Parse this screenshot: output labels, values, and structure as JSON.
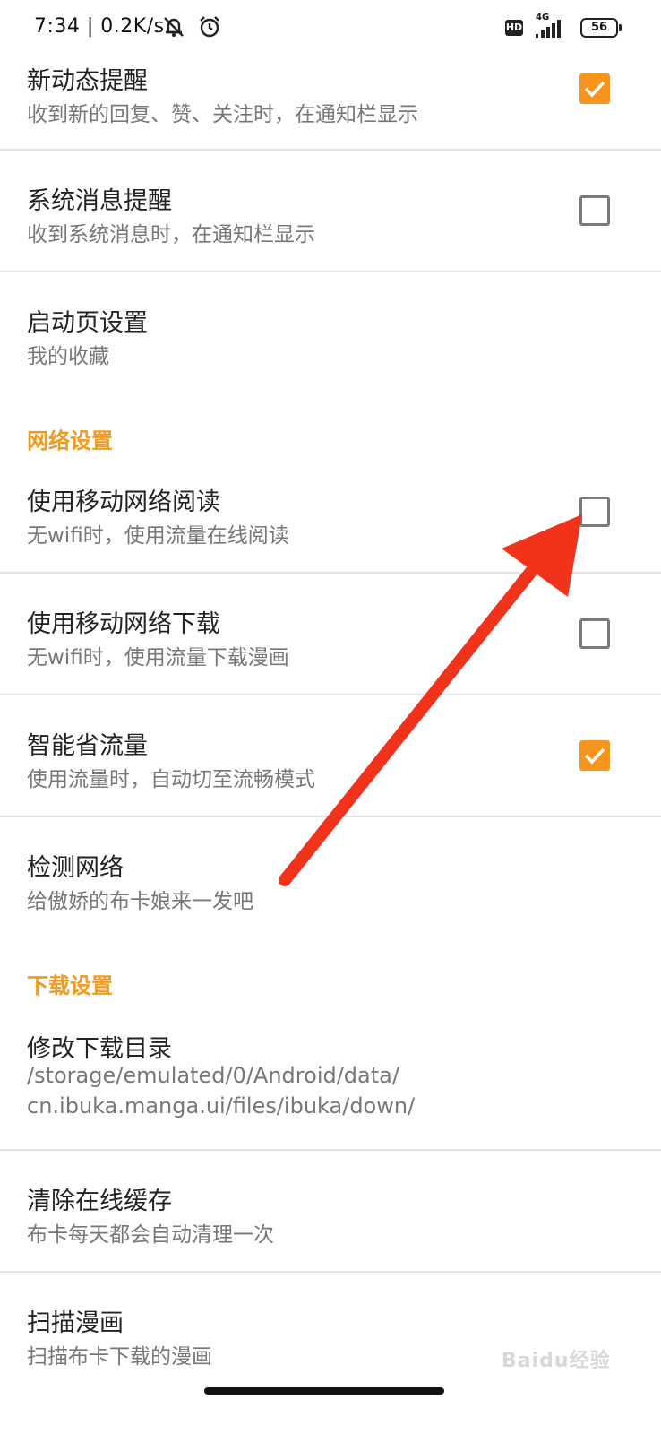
{
  "status_bar": {
    "time_speed": "7:34 | 0.2K/s",
    "hd": "HD",
    "network": "4G",
    "battery": "56"
  },
  "settings": {
    "new_activity": {
      "title": "新动态提醒",
      "subtitle": "收到新的回复、赞、关注时，在通知栏显示",
      "checked": true
    },
    "system_message": {
      "title": "系统消息提醒",
      "subtitle": "收到系统消息时，在通知栏显示",
      "checked": false
    },
    "launch_page": {
      "title": "启动页设置",
      "subtitle": "我的收藏"
    },
    "network_section": "网络设置",
    "mobile_read": {
      "title": "使用移动网络阅读",
      "subtitle": "无wifi时，使用流量在线阅读",
      "checked": false
    },
    "mobile_download": {
      "title": "使用移动网络下载",
      "subtitle": "无wifi时，使用流量下载漫画",
      "checked": false
    },
    "smart_data": {
      "title": "智能省流量",
      "subtitle": "使用流量时，自动切至流畅模式",
      "checked": true
    },
    "check_network": {
      "title": "检测网络",
      "subtitle": "给傲娇的布卡娘来一发吧"
    },
    "download_section": "下载设置",
    "download_dir": {
      "title": "修改下载目录",
      "subtitle_line1": "/storage/emulated/0/Android/data/",
      "subtitle_line2": "cn.ibuka.manga.ui/files/ibuka/down/"
    },
    "clear_cache": {
      "title": "清除在线缓存",
      "subtitle": "布卡每天都会自动清理一次"
    },
    "scan_manga": {
      "title": "扫描漫画",
      "subtitle": "扫描布卡下载的漫画"
    }
  },
  "watermark": "Baidu经验",
  "colors": {
    "accent": "#f7941d",
    "arrow": "#f0331a",
    "section": "#f39a1e"
  }
}
